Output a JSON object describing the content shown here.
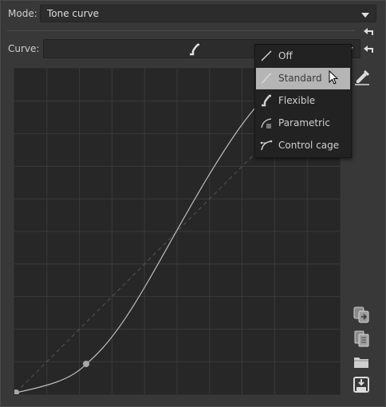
{
  "mode": {
    "label": "Mode:",
    "value": "Tone curve"
  },
  "curve": {
    "label": "Curve:"
  },
  "curve_menu": {
    "selected_index": 1,
    "items": [
      {
        "label": "Off",
        "icon": "linear-curve-icon"
      },
      {
        "label": "Standard",
        "icon": "standard-curve-icon"
      },
      {
        "label": "Flexible",
        "icon": "flexible-curve-icon"
      },
      {
        "label": "Parametric",
        "icon": "parametric-curve-icon"
      },
      {
        "label": "Control cage",
        "icon": "control-cage-icon"
      }
    ]
  },
  "colors": {
    "background": "#383838",
    "graph_background": "#272727",
    "grid": "#3a3a3a",
    "curve": "#bdbdbd",
    "menu_background": "#222222",
    "menu_selected": "#b5b5b5"
  }
}
